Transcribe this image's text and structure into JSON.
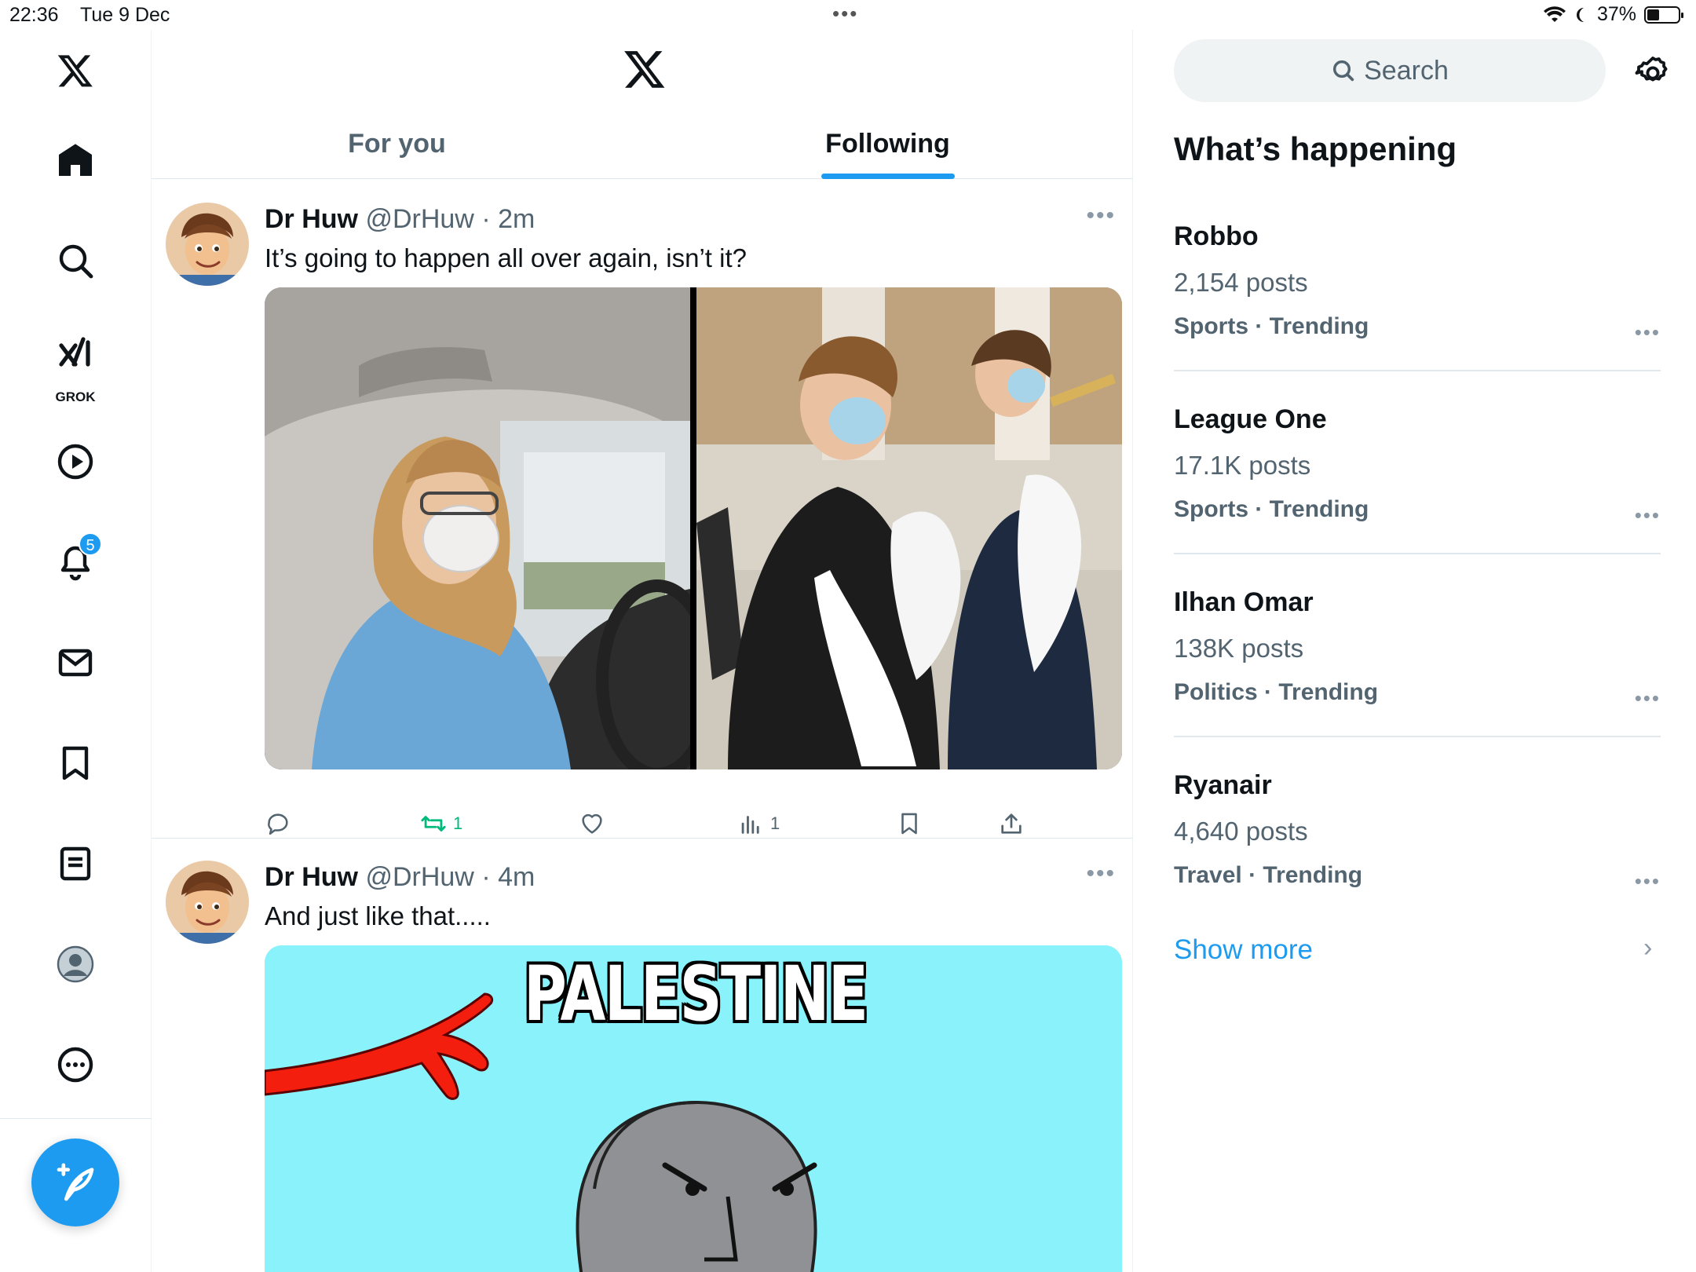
{
  "status_bar": {
    "time": "22:36",
    "date": "Tue 9 Dec",
    "battery": "37%",
    "battery_level": 0.37
  },
  "nav": {
    "items": [
      "home",
      "explore",
      "grok",
      "video",
      "notifications",
      "messages",
      "bookmarks",
      "lists",
      "profile",
      "more"
    ],
    "grok_label": "GROK",
    "notification_count": "5"
  },
  "tabs": [
    {
      "label": "For you",
      "active": false
    },
    {
      "label": "Following",
      "active": true
    }
  ],
  "tweets": [
    {
      "name": "Dr Huw",
      "handle": "@DrHuw",
      "time": "2m",
      "text": "It’s going to happen all over again, isn’t it?",
      "retweets": "1",
      "views": "1"
    },
    {
      "name": "Dr Huw",
      "handle": "@DrHuw",
      "time": "4m",
      "text": "And just like that.....",
      "image_text": "PALESTINE"
    }
  ],
  "sidebar": {
    "search_placeholder": "Search",
    "heading": "What’s happening",
    "trends": [
      {
        "name": "Robbo",
        "count": "2,154 posts",
        "category": "Sports · Trending"
      },
      {
        "name": "League One",
        "count": "17.1K posts",
        "category": "Sports · Trending"
      },
      {
        "name": "Ilhan Omar",
        "count": "138K posts",
        "category": "Politics · Trending"
      },
      {
        "name": "Ryanair",
        "count": "4,640 posts",
        "category": "Travel · Trending"
      }
    ],
    "show_more": "Show more"
  },
  "colors": {
    "accent": "#1d9bf0",
    "retweet_green": "#00ba7c",
    "secondary_text": "#536471"
  }
}
